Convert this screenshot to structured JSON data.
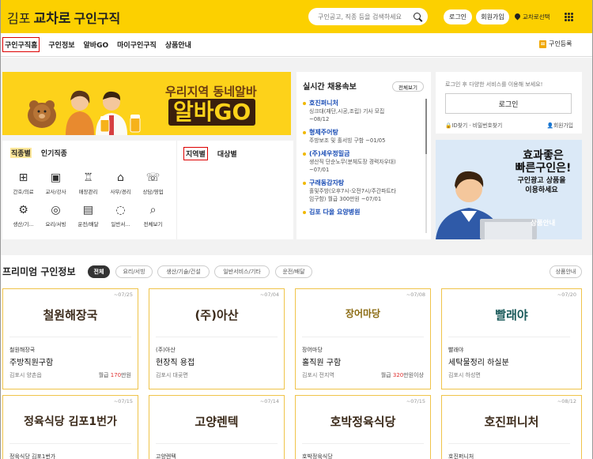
{
  "header": {
    "logo_part1": "김포",
    "logo_part2": "교차로",
    "logo_part3": "구인구직",
    "search_placeholder": "구인공고, 직종 등을 검색하세요",
    "login": "로그인",
    "join": "회원가입",
    "location": "교차로선택",
    "accent_color": "#fcd000"
  },
  "nav": {
    "items": [
      "구인구직홈",
      "구인정보",
      "알바GO",
      "마이구인구직",
      "상품안내"
    ],
    "register": "구인등록"
  },
  "banner": {
    "line1": "우리지역 동네알바",
    "line2a": "알바",
    "line2b": "GO"
  },
  "categories": {
    "tab1": "직종별",
    "tab2": "인기직종",
    "items": [
      {
        "label": "간호/의료",
        "icon": "medical-bag-icon"
      },
      {
        "label": "교사/강사",
        "icon": "board-icon"
      },
      {
        "label": "매장관리",
        "icon": "shirt-icon"
      },
      {
        "label": "사무/경리",
        "icon": "desk-icon"
      },
      {
        "label": "상담/영업",
        "icon": "headset-icon"
      },
      {
        "label": "생산/기...",
        "icon": "gear-icon"
      },
      {
        "label": "요리/서빙",
        "icon": "dish-icon"
      },
      {
        "label": "운전/배달",
        "icon": "truck-icon"
      },
      {
        "label": "일반서...",
        "icon": "chat-icon"
      },
      {
        "label": "전체보기",
        "icon": "search-icon"
      }
    ]
  },
  "region": {
    "tab1": "지역별",
    "tab2": "대상별"
  },
  "realtime": {
    "title": "실시간 채용속보",
    "view_all": "전체보기",
    "items": [
      {
        "company": "호진퍼니처",
        "desc1": "싱크대(재단,시공,조립) 기사 모집",
        "desc2": "~08/12"
      },
      {
        "company": "형제주어탕",
        "desc1": "주방보조 및 홀서빙 구함 ~01/05",
        "desc2": ""
      },
      {
        "company": "(주)세우정밀금",
        "desc1": "생산직 단순노무(분체도장 경력자우대)",
        "desc2": "~07/01"
      },
      {
        "company": "구래동감자탕",
        "desc1": "홀및주방(오후7시-오전7시/주간파트타",
        "desc2": "임구함) 월급 300만원 ~07/01"
      },
      {
        "company": "김포 다올 요양병원",
        "desc1": "",
        "desc2": ""
      }
    ]
  },
  "login_box": {
    "message": "로그인 후 다양한 서비스를 이용해 보세요!",
    "button": "로그인",
    "find_id": "ID찾기",
    "find_pw": "비밀번호찾기",
    "join": "회원가입"
  },
  "promo": {
    "line1": "효과좋은",
    "line2": "빠른구인은!",
    "line3": "구인광고 상품을",
    "line4": "이용하세요",
    "button": "상품안내"
  },
  "premium": {
    "title": "프리미엄 구인정보",
    "chips": [
      "전체",
      "요리/서빙",
      "생산/기술/건설",
      "일반서비스/기타",
      "운전/배달"
    ],
    "goods": "상품안내",
    "cards": [
      {
        "date": "~07/25",
        "logo": "철원해장국",
        "company": "철원해장국",
        "title": "주방직원구함",
        "location": "김포시 양촌읍",
        "pay_prefix": "월급",
        "pay_amount": "170",
        "pay_suffix": "만원"
      },
      {
        "date": "~07/04",
        "logo": "(주)아산",
        "company": "(주)아산",
        "title": "현장직 용접",
        "location": "김포시 대곶면",
        "pay_prefix": "",
        "pay_amount": "",
        "pay_suffix": ""
      },
      {
        "date": "~07/08",
        "logo": "장어마당",
        "company": "장어마당",
        "title": "홀직원 구함",
        "location": "김포시 전지역",
        "pay_prefix": "월급",
        "pay_amount": "320",
        "pay_suffix": "만원이상"
      },
      {
        "date": "~07/20",
        "logo": "빨래야",
        "company": "빨래야",
        "title": "세탁물정리 하실분",
        "location": "김포시 하성면",
        "pay_prefix": "",
        "pay_amount": "",
        "pay_suffix": ""
      },
      {
        "date": "~07/15",
        "logo": "정육식당 김포1번가",
        "company": "정육식당 김포1번가",
        "title": "",
        "location": "",
        "pay_prefix": "",
        "pay_amount": "",
        "pay_suffix": ""
      },
      {
        "date": "~07/14",
        "logo": "고양렌텍",
        "company": "고양렌텍",
        "title": "",
        "location": "",
        "pay_prefix": "",
        "pay_amount": "",
        "pay_suffix": ""
      },
      {
        "date": "~07/15",
        "logo": "호박정육식당",
        "company": "호박정육식당",
        "title": "",
        "location": "",
        "pay_prefix": "",
        "pay_amount": "",
        "pay_suffix": ""
      },
      {
        "date": "~08/12",
        "logo": "호진퍼니처",
        "company": "호진퍼니처",
        "title": "",
        "location": "",
        "pay_prefix": "",
        "pay_amount": "",
        "pay_suffix": ""
      }
    ]
  }
}
